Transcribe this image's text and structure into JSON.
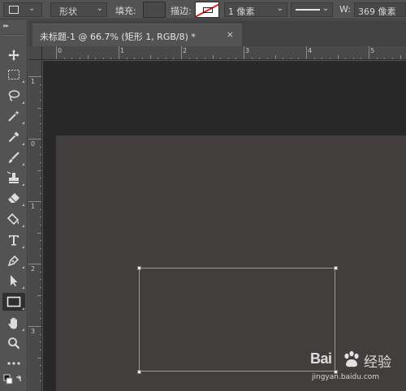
{
  "options_bar": {
    "tool_mode": "形状",
    "fill_label": "填充:",
    "stroke_label": "描边:",
    "stroke_width": "1 像素",
    "width_label": "W:",
    "width_value": "369 像素",
    "fill_color": "#4b4848",
    "stroke_color": "#e02020"
  },
  "tools": [
    {
      "name": "move-tool",
      "icon": "move-icon"
    },
    {
      "name": "marquee-tool",
      "icon": "rect-marquee-icon"
    },
    {
      "name": "lasso-tool",
      "icon": "lasso-icon"
    },
    {
      "name": "magic-wand-tool",
      "icon": "magic-wand-icon"
    },
    {
      "name": "eyedropper-tool",
      "icon": "eyedropper-icon"
    },
    {
      "name": "brush-tool",
      "icon": "brush-icon"
    },
    {
      "name": "stamp-tool",
      "icon": "clone-stamp-icon"
    },
    {
      "name": "eraser-tool",
      "icon": "eraser-icon"
    },
    {
      "name": "paint-bucket-tool",
      "icon": "paint-bucket-icon"
    },
    {
      "name": "type-tool",
      "icon": "type-icon"
    },
    {
      "name": "pen-tool",
      "icon": "pen-icon"
    },
    {
      "name": "path-selection-tool",
      "icon": "arrow-icon"
    },
    {
      "name": "rectangle-tool",
      "icon": "rectangle-icon",
      "active": true
    },
    {
      "name": "hand-tool",
      "icon": "hand-icon"
    },
    {
      "name": "zoom-tool",
      "icon": "zoom-icon"
    },
    {
      "name": "more-tools",
      "icon": "ellipsis-icon"
    }
  ],
  "document_tab": {
    "title": "未标题-1 @ 66.7% (矩形 1, RGB/8) *",
    "close": "×"
  },
  "ruler_h": [
    "0",
    "1",
    "2",
    "3",
    "4",
    "5"
  ],
  "ruler_v": [
    "1",
    "0",
    "1",
    "2",
    "3"
  ],
  "watermark": {
    "brand": "Bai",
    "cn": "经验",
    "url": "jingyan.baidu.com"
  }
}
